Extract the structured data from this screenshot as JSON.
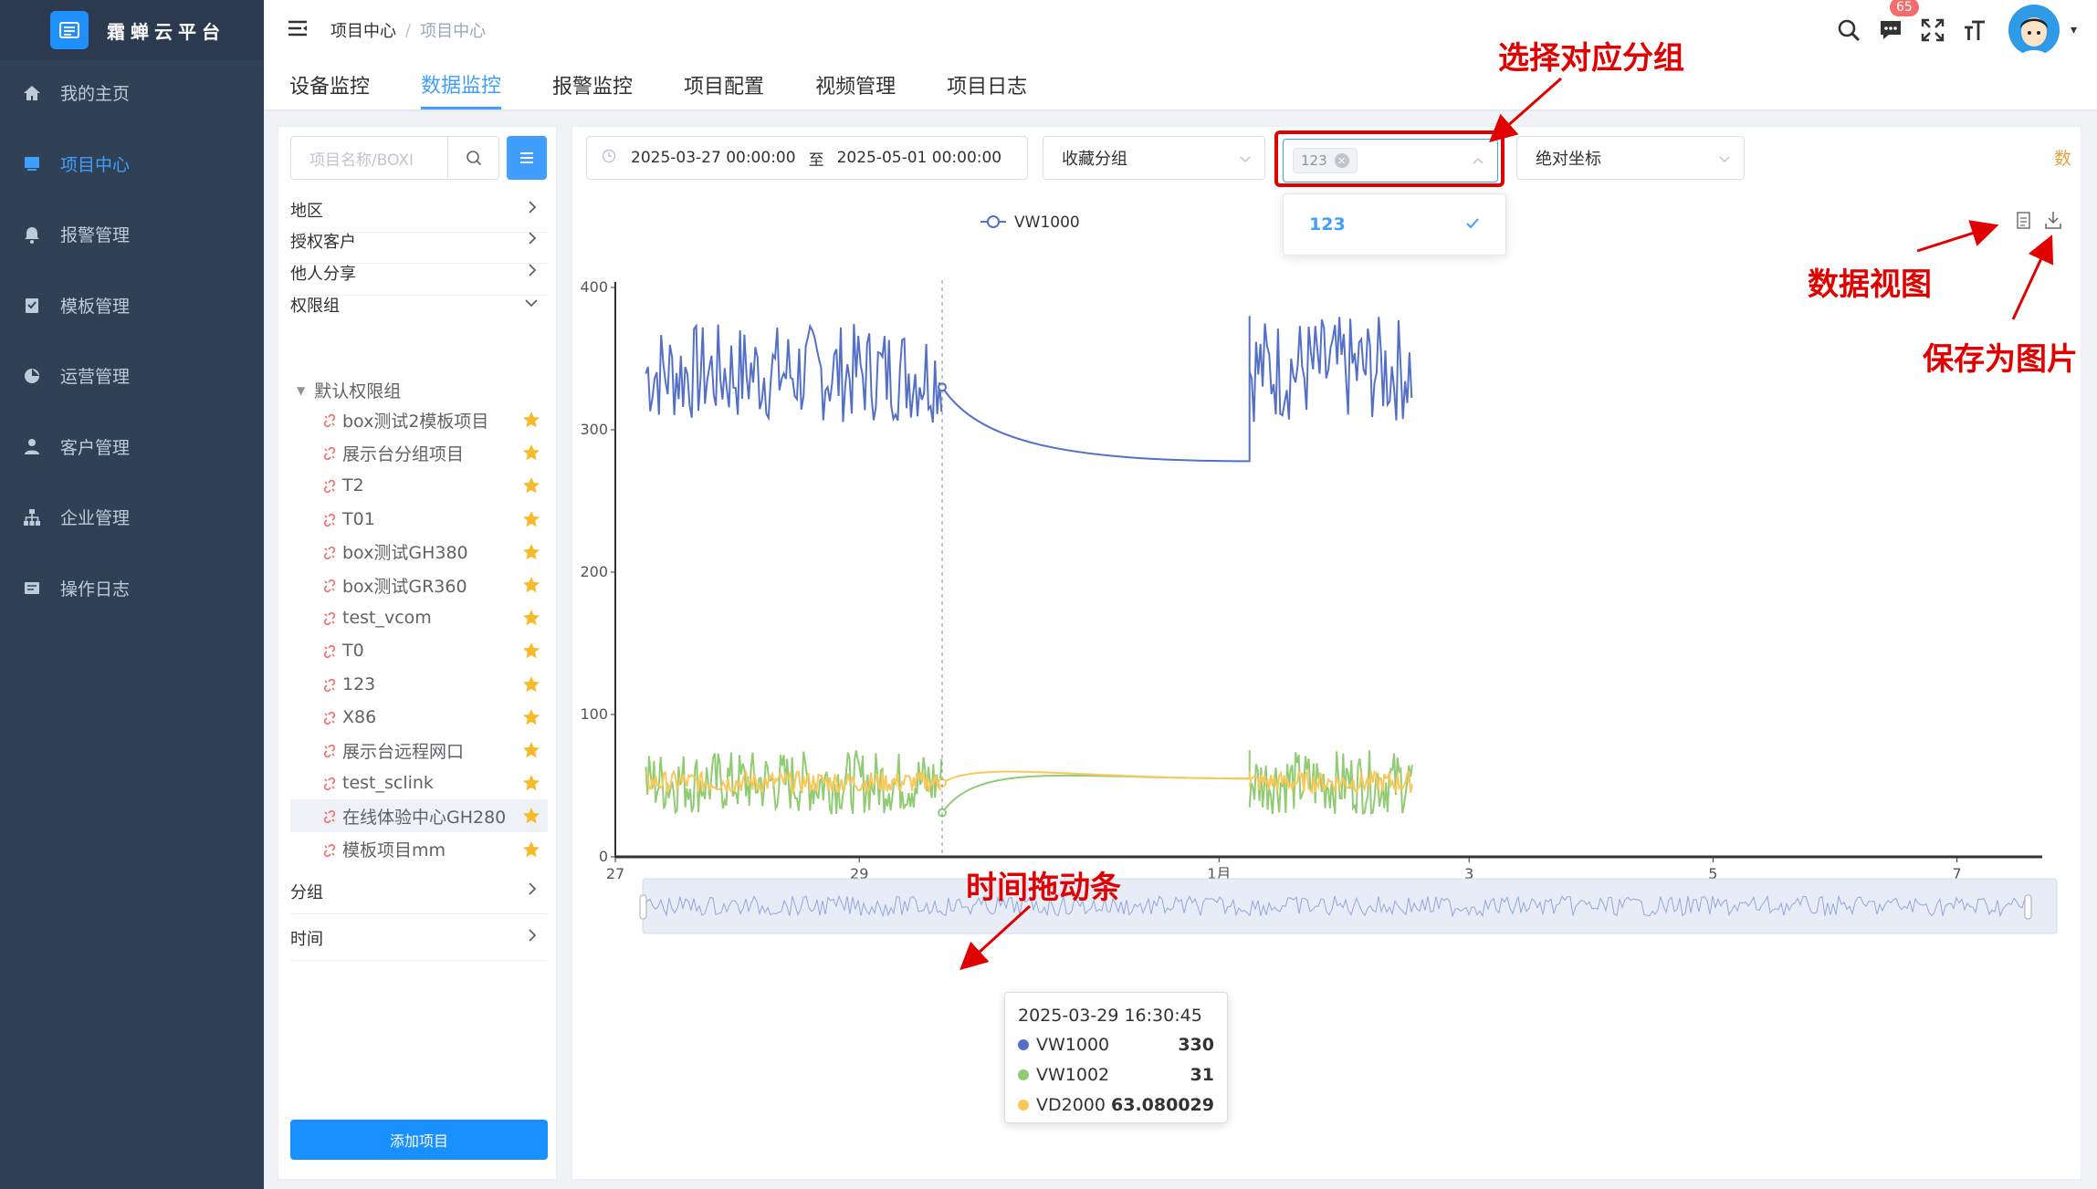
{
  "app": {
    "title": "霜蝉云平台"
  },
  "sidebar": {
    "items": [
      {
        "label": "我的主页",
        "icon": "home-icon",
        "active": false
      },
      {
        "label": "项目中心",
        "icon": "monitor-icon",
        "active": true
      },
      {
        "label": "报警管理",
        "icon": "bell-icon",
        "active": false
      },
      {
        "label": "模板管理",
        "icon": "clipboard-icon",
        "active": false
      },
      {
        "label": "运营管理",
        "icon": "pie-icon",
        "active": false
      },
      {
        "label": "客户管理",
        "icon": "user-icon",
        "active": false
      },
      {
        "label": "企业管理",
        "icon": "org-icon",
        "active": false
      },
      {
        "label": "操作日志",
        "icon": "log-icon",
        "active": false
      }
    ]
  },
  "header": {
    "breadcrumb": [
      "项目中心",
      "项目中心"
    ],
    "sep": "/",
    "notification_count": "65"
  },
  "tabs": [
    "设备监控",
    "数据监控",
    "报警监控",
    "项目配置",
    "视频管理",
    "项目日志"
  ],
  "left": {
    "search_placeholder": "项目名称/BOXI",
    "sections": {
      "region": "地区",
      "auth": "授权客户",
      "share": "他人分享",
      "perm": "权限组",
      "group": "分组",
      "time": "时间"
    },
    "default_group": "默认权限组",
    "projects": [
      "box测试2模板项目",
      "展示台分组项目",
      "T2",
      "T01",
      "box测试GH380",
      "box测试GR360",
      "test_vcom",
      "T0",
      "123",
      "X86",
      "展示台远程网口",
      "test_sclink",
      "在线体验中心GH280",
      "模板项目mm"
    ],
    "add_button": "添加项目"
  },
  "filters": {
    "date_start": "2025-03-27 00:00:00",
    "date_sep": "至",
    "date_end": "2025-05-01 00:00:00",
    "favorite_group": "收藏分组",
    "selected_tag": "123",
    "coord_mode": "绝对坐标",
    "right_cut_label": "数",
    "dropdown_option": "123"
  },
  "chart_data": {
    "type": "line",
    "legend_visible": [
      "VW1000"
    ],
    "ylim": [
      0,
      400
    ],
    "yticks": [
      "0",
      "100",
      "200",
      "300",
      "400"
    ],
    "xticks": [
      "27",
      "29",
      "1月",
      "3",
      "5",
      "7"
    ],
    "series": [
      {
        "name": "VW1000",
        "color": "#5470c6",
        "segments": [
          {
            "x": [
              "2025-03-27 06:00",
              "2025-03-29 16:30"
            ],
            "range": [
              305,
              375
            ]
          },
          {
            "x": [
              "2025-04-01 08:00",
              "2025-04-03 04:00"
            ],
            "range": [
              305,
              380
            ]
          }
        ],
        "gap_curve": {
          "from": 330,
          "to": 278
        }
      },
      {
        "name": "VW1002",
        "color": "#91cc75",
        "segments": [
          {
            "x": [
              "2025-03-27 06:00",
              "2025-03-29 16:30"
            ],
            "range": [
              30,
              75
            ]
          },
          {
            "x": [
              "2025-04-01 08:00",
              "2025-04-03 04:00"
            ],
            "range": [
              30,
              75
            ]
          }
        ],
        "gap_curve": {
          "from": 31,
          "to": 55
        }
      },
      {
        "name": "VD2000",
        "color": "#fac858",
        "segments": [
          {
            "x": [
              "2025-03-27 06:00",
              "2025-03-29 16:30"
            ],
            "range": [
              45,
              60
            ]
          },
          {
            "x": [
              "2025-04-01 08:00",
              "2025-04-03 04:00"
            ],
            "range": [
              45,
              60
            ]
          }
        ],
        "gap_curve": {
          "from": 52,
          "to": 55
        }
      }
    ],
    "tooltip": {
      "time": "2025-03-29 16:30:45",
      "rows": [
        {
          "name": "VW1000",
          "value": "330",
          "color": "#5470c6"
        },
        {
          "name": "VW1002",
          "value": "31",
          "color": "#91cc75"
        },
        {
          "name": "VD2000",
          "value": "63.080029",
          "color": "#fac858"
        }
      ]
    }
  },
  "annotations": {
    "select_group": "选择对应分组",
    "data_view": "数据视图",
    "save_image": "保存为图片",
    "time_slider": "时间拖动条"
  }
}
